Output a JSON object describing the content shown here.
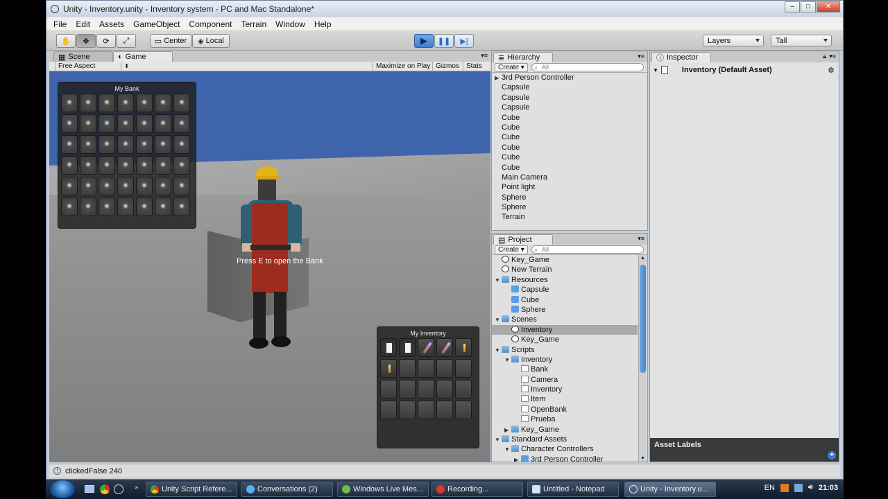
{
  "window": {
    "title": "Unity - Inventory.unity - Inventory system - PC and Mac Standalone*"
  },
  "menu": [
    "File",
    "Edit",
    "Assets",
    "GameObject",
    "Component",
    "Terrain",
    "Window",
    "Help"
  ],
  "toolbar": {
    "center_label": "Center",
    "local_label": "Local",
    "layers_label": "Layers",
    "layout_label": "Tall"
  },
  "tabs": {
    "scene": "Scene",
    "game": "Game"
  },
  "gamebar": {
    "aspect": "Free Aspect",
    "maximize": "Maximize on Play",
    "gizmos": "Gizmos",
    "stats": "Stats"
  },
  "game": {
    "bank_title": "My Bank",
    "inventory_title": "My Inventory",
    "message": "Press E to open the Bank"
  },
  "status": {
    "text": "clickedFalse 240"
  },
  "hierarchy": {
    "tab": "Hierarchy",
    "create": "Create",
    "search_placeholder": "All",
    "items": [
      "3rd Person Controller",
      "Capsule",
      "Capsule",
      "Capsule",
      "Cube",
      "Cube",
      "Cube",
      "Cube",
      "Cube",
      "Cube",
      "Main Camera",
      "Point light",
      "Sphere",
      "Sphere",
      "Terrain"
    ]
  },
  "project": {
    "tab": "Project",
    "create": "Create",
    "search_placeholder": "All",
    "items": [
      {
        "label": "Key_Game",
        "indent": 0,
        "icon": "unity",
        "arrow": ""
      },
      {
        "label": "New Terrain",
        "indent": 0,
        "icon": "terrain",
        "arrow": ""
      },
      {
        "label": "Resources",
        "indent": 0,
        "icon": "folder",
        "arrow": "▼"
      },
      {
        "label": "Capsule",
        "indent": 1,
        "icon": "cube",
        "arrow": ""
      },
      {
        "label": "Cube",
        "indent": 1,
        "icon": "cube",
        "arrow": ""
      },
      {
        "label": "Sphere",
        "indent": 1,
        "icon": "cube",
        "arrow": ""
      },
      {
        "label": "Scenes",
        "indent": 0,
        "icon": "folder",
        "arrow": "▼"
      },
      {
        "label": "Inventory",
        "indent": 1,
        "icon": "unity",
        "arrow": "",
        "selected": true
      },
      {
        "label": "Key_Game",
        "indent": 1,
        "icon": "unity",
        "arrow": ""
      },
      {
        "label": "Scripts",
        "indent": 0,
        "icon": "folder",
        "arrow": "▼"
      },
      {
        "label": "Inventory",
        "indent": 1,
        "icon": "folder",
        "arrow": "▼"
      },
      {
        "label": "Bank",
        "indent": 2,
        "icon": "script",
        "arrow": ""
      },
      {
        "label": "Camera",
        "indent": 2,
        "icon": "script",
        "arrow": ""
      },
      {
        "label": "Inventory",
        "indent": 2,
        "icon": "script",
        "arrow": ""
      },
      {
        "label": "Item",
        "indent": 2,
        "icon": "script",
        "arrow": ""
      },
      {
        "label": "OpenBank",
        "indent": 2,
        "icon": "script",
        "arrow": ""
      },
      {
        "label": "Prueba",
        "indent": 2,
        "icon": "script",
        "arrow": ""
      },
      {
        "label": "Key_Game",
        "indent": 1,
        "icon": "folder",
        "arrow": "▶"
      },
      {
        "label": "Standard Assets",
        "indent": 0,
        "icon": "folder",
        "arrow": "▼"
      },
      {
        "label": "Character Controllers",
        "indent": 1,
        "icon": "folder",
        "arrow": "▼"
      },
      {
        "label": "3rd Person Controller",
        "indent": 2,
        "icon": "cube",
        "arrow": "▶"
      }
    ]
  },
  "inspector": {
    "tab": "Inspector",
    "title": "Inventory (Default Asset)",
    "asset_labels": "Asset Labels"
  },
  "taskbar": {
    "items": [
      "Unity Script Refere...",
      "Conversations (2)",
      "Windows Live Mes...",
      "Recording...",
      "Untitled - Notepad",
      "Unity - Inventory.u..."
    ],
    "lang": "EN",
    "clock": "21:03"
  },
  "inventory_slots": [
    "paper",
    "paper",
    "wand",
    "wand",
    "candle",
    "candle",
    "empty",
    "empty",
    "empty",
    "empty",
    "empty",
    "empty",
    "empty",
    "empty",
    "empty",
    "empty",
    "empty",
    "empty",
    "empty",
    "empty"
  ]
}
